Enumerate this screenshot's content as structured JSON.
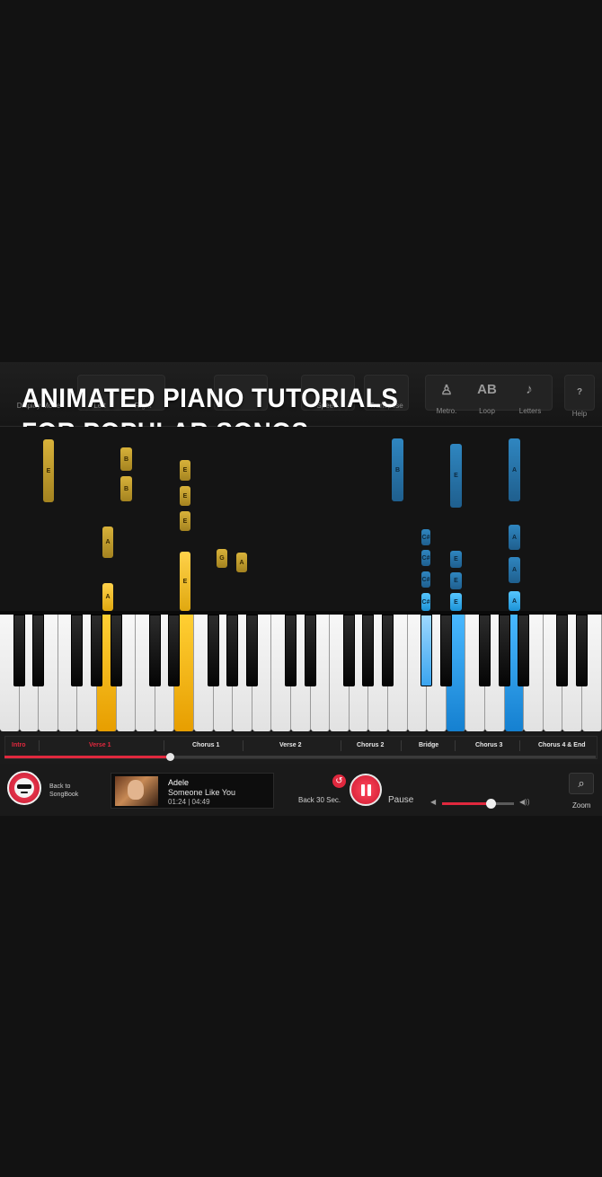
{
  "headline": {
    "line1": "ANIMATED PIANO TUTORIALS",
    "line2": "FOR POPULAR SONGS"
  },
  "toolbar": {
    "display_mode": "Display Mode",
    "left": "Left",
    "right": "Right",
    "speed": "Speed",
    "transpose": "Transpose",
    "metro": "Metro.",
    "loop": "Loop",
    "loop_glyph": "AB",
    "letters": "Letters",
    "letters_glyph": "♪",
    "metro_glyph": "♙",
    "help": "Help",
    "help_glyph": "?"
  },
  "notes": {
    "gold": [
      "E",
      "B",
      "B",
      "E",
      "E",
      "E",
      "A",
      "G",
      "A",
      "A",
      "E"
    ],
    "blue": [
      "B",
      "E",
      "A",
      "C#",
      "C#",
      "C#",
      "C#",
      "E",
      "E",
      "E",
      "A",
      "A",
      "A"
    ]
  },
  "sections": {
    "items": [
      "Intro",
      "Verse 1",
      "Chorus 1",
      "Verse 2",
      "Chorus 2",
      "Bridge",
      "Chorus 3",
      "Chorus 4 & End"
    ],
    "active_color": "#e0283e",
    "progress_fraction": 0.28
  },
  "player": {
    "back_label_line1": "Back to",
    "back_label_line2": "SongBook",
    "artist": "Adele",
    "song_title": "Someone Like You",
    "time": "01:24 | 04:49",
    "back30_label": "Back 30 Sec.",
    "pause_label": "Pause",
    "volume_fraction": 0.67,
    "zoom_label": "Zoom"
  },
  "colors": {
    "accent": "#e0283e",
    "left_hand": "#ffc21a",
    "right_hand": "#2fa5f0"
  }
}
